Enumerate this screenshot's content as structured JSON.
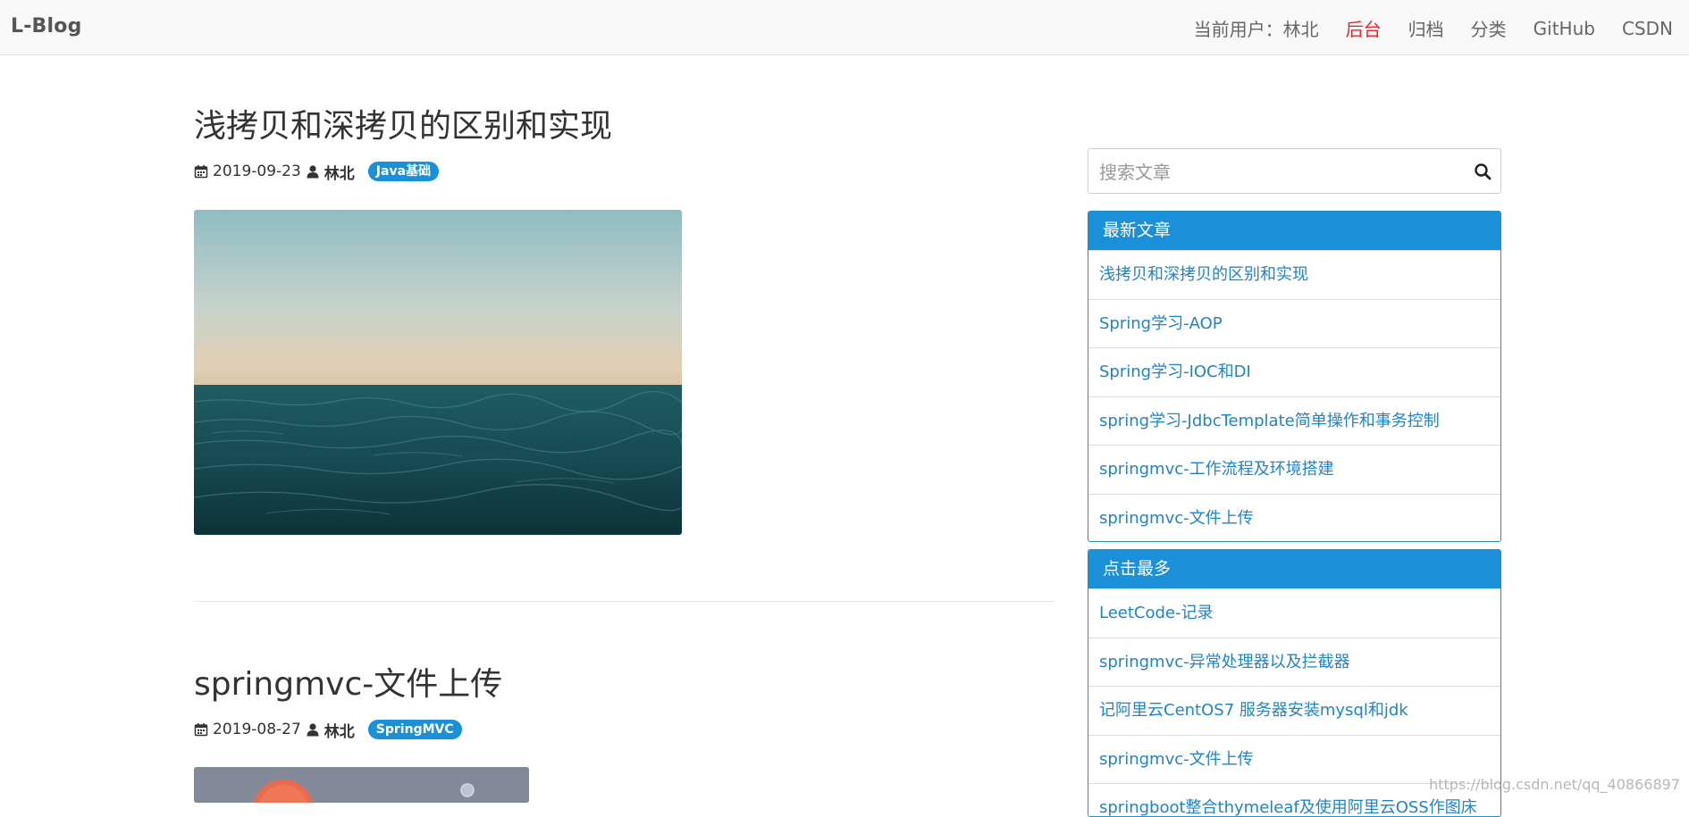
{
  "nav": {
    "brand": "L-Blog",
    "current_user": "当前用户：林北",
    "admin": "后台",
    "archive": "归档",
    "category": "分类",
    "github": "GitHub",
    "csdn": "CSDN"
  },
  "posts": [
    {
      "title": "浅拷贝和深拷贝的区别和实现",
      "date": "2019-09-23",
      "author": "林北",
      "tag": "Java基础"
    },
    {
      "title": "springmvc-文件上传",
      "date": "2019-08-27",
      "author": "林北",
      "tag": "SpringMVC"
    }
  ],
  "search": {
    "placeholder": "搜索文章"
  },
  "latest": {
    "heading": "最新文章",
    "items": [
      "浅拷贝和深拷贝的区别和实现",
      "Spring学习-AOP",
      "Spring学习-IOC和DI",
      "spring学习-JdbcTemplate简单操作和事务控制",
      "springmvc-工作流程及环境搭建",
      "springmvc-文件上传"
    ]
  },
  "popular": {
    "heading": "点击最多",
    "items": [
      "LeetCode-记录",
      "springmvc-异常处理器以及拦截器",
      "记阿里云CentOS7 服务器安装mysql和jdk",
      "springmvc-文件上传",
      "springboot整合thymeleaf及使用阿里云OSS作图床"
    ]
  },
  "watermark": "https://blog.csdn.net/qq_40866897",
  "colors": {
    "accent": "#1b8fd7",
    "admin": "#e8272e",
    "link": "#1f84c8"
  }
}
